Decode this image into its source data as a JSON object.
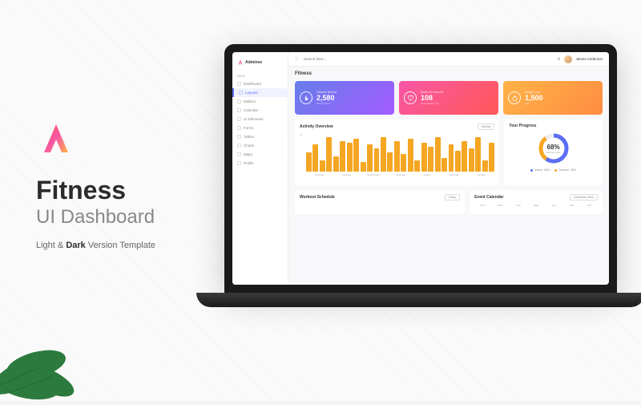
{
  "marketing": {
    "title": "Fitness",
    "subtitle": "UI Dashboard",
    "tagline_pre": "Light & ",
    "tagline_dark": "Dark",
    "tagline_post": " Version Template"
  },
  "brand": {
    "name": "Adminse"
  },
  "sidebar": {
    "section": "MENU",
    "items": [
      {
        "label": "Dashboard",
        "active": false
      },
      {
        "label": "Layouts",
        "active": true,
        "expand": true
      },
      {
        "label": "Mailbox",
        "active": false
      },
      {
        "label": "Calendar",
        "active": false
      },
      {
        "label": "UI Elements",
        "active": false,
        "expand": true
      },
      {
        "label": "Forms",
        "active": false
      },
      {
        "label": "Tables",
        "active": false,
        "expand": true
      },
      {
        "label": "Charts",
        "active": false,
        "expand": true
      },
      {
        "label": "Maps",
        "active": false,
        "expand": true
      },
      {
        "label": "Profile",
        "active": false
      }
    ]
  },
  "topbar": {
    "search_placeholder": "Search here...",
    "user": "James Anderson"
  },
  "page": {
    "title": "Fitness"
  },
  "stats": [
    {
      "label": "Calories Burned",
      "value": "2,580",
      "sub": "KCal burned"
    },
    {
      "label": "Beats Per Second",
      "value": "108",
      "sub": "Last checkup: 72"
    },
    {
      "label": "Weight Loss",
      "value": "1,500",
      "sub": "gain"
    }
  ],
  "activity": {
    "title": "Activity Overview",
    "filter": "Weekly",
    "ymax": "2k"
  },
  "progress": {
    "title": "Your Progress",
    "percent": "68%",
    "label": "Calories eaten",
    "legend": [
      {
        "name": "Indoor",
        "val": "60%"
      },
      {
        "name": "Outdoor",
        "val": "30%"
      }
    ]
  },
  "workout": {
    "title": "Workout Schedule",
    "filter": "Today"
  },
  "calendar": {
    "title": "Event Calendar",
    "month": "December 2024",
    "days": [
      "SUN",
      "MON",
      "TUE",
      "WED",
      "THU",
      "FRI",
      "SAT"
    ]
  },
  "chart_data": {
    "type": "bar",
    "title": "Activity Overview",
    "xlabel": "",
    "ylabel": "",
    "ylim": [
      0,
      2000
    ],
    "categories": [
      "Monday",
      "Tuesday",
      "Wednesday",
      "Thursday",
      "Friday",
      "Saturday",
      "Sunday"
    ],
    "values": [
      1000,
      1400,
      600,
      1800,
      800,
      1600,
      1500,
      1700,
      500,
      1400,
      1200,
      1800,
      1000,
      1600,
      900,
      1700,
      600,
      1500,
      1300,
      1800,
      700,
      1400,
      1100,
      1600,
      1200,
      1800,
      600,
      1500
    ],
    "progress_donut": {
      "percent": 68,
      "indoor": 60,
      "outdoor": 30
    }
  }
}
